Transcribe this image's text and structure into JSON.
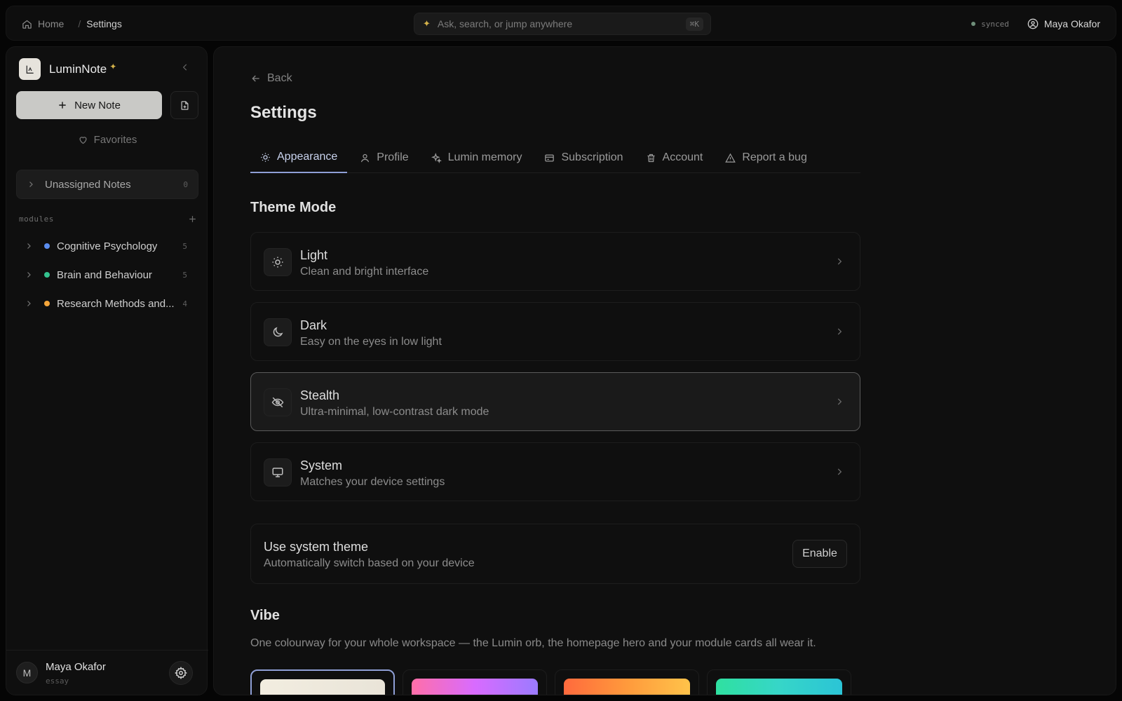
{
  "topbar": {
    "breadcrumbs": [
      "Home",
      "Settings"
    ],
    "search_placeholder": "Ask, search, or jump anywhere",
    "search_shortcut": "⌘K",
    "sync_status": "synced",
    "user_name": "Maya Okafor"
  },
  "sidebar": {
    "app_name": "LuminNote",
    "new_note_label": "New Note",
    "favorites_label": "Favorites",
    "unassigned": {
      "label": "Unassigned Notes",
      "count": "0"
    },
    "modules_heading": "modules",
    "modules": [
      {
        "name": "Cognitive Psychology",
        "count": "5",
        "color": "#5b8def"
      },
      {
        "name": "Brain and Behaviour",
        "count": "5",
        "color": "#34c38f"
      },
      {
        "name": "Research Methods and...",
        "count": "4",
        "color": "#f4a53a"
      }
    ],
    "footer": {
      "avatar_initial": "M",
      "name": "Maya Okafor",
      "subtitle": "essay"
    }
  },
  "main": {
    "back_label": "Back",
    "title": "Settings",
    "tabs": [
      {
        "label": "Appearance",
        "icon": "sun-icon",
        "active": true
      },
      {
        "label": "Profile",
        "icon": "user-icon",
        "active": false
      },
      {
        "label": "Lumin memory",
        "icon": "sparkles-icon",
        "active": false
      },
      {
        "label": "Subscription",
        "icon": "credit-card-icon",
        "active": false
      },
      {
        "label": "Account",
        "icon": "trash-icon",
        "active": false
      },
      {
        "label": "Report a bug",
        "icon": "warning-icon",
        "active": false
      }
    ],
    "theme_mode_title": "Theme Mode",
    "theme_options": [
      {
        "title": "Light",
        "desc": "Clean and bright interface",
        "icon": "sun-icon",
        "selected": false
      },
      {
        "title": "Dark",
        "desc": "Easy on the eyes in low light",
        "icon": "moon-icon",
        "selected": false
      },
      {
        "title": "Stealth",
        "desc": "Ultra-minimal, low-contrast dark mode",
        "icon": "eye-off-icon",
        "selected": true
      },
      {
        "title": "System",
        "desc": "Matches your device settings",
        "icon": "monitor-icon",
        "selected": false
      }
    ],
    "system_theme": {
      "title": "Use system theme",
      "desc": "Automatically switch based on your device",
      "button": "Enable"
    },
    "vibe_title": "Vibe",
    "vibe_desc": "One colourway for your whole workspace — the Lumin orb, the homepage hero and your module cards all wear it.",
    "vibes": [
      {
        "gradient": "linear-gradient(90deg,#f2ede0,#e9e4d8)",
        "selected": true
      },
      {
        "gradient": "linear-gradient(90deg,#ff6fa8,#d86bff,#9b7bff)",
        "selected": false
      },
      {
        "gradient": "linear-gradient(90deg,#ff6a3d,#ff9a3c,#ffc34a)",
        "selected": false
      },
      {
        "gradient": "linear-gradient(90deg,#2fe0a0,#36d6c8,#2bc4d6)",
        "selected": false
      }
    ]
  }
}
